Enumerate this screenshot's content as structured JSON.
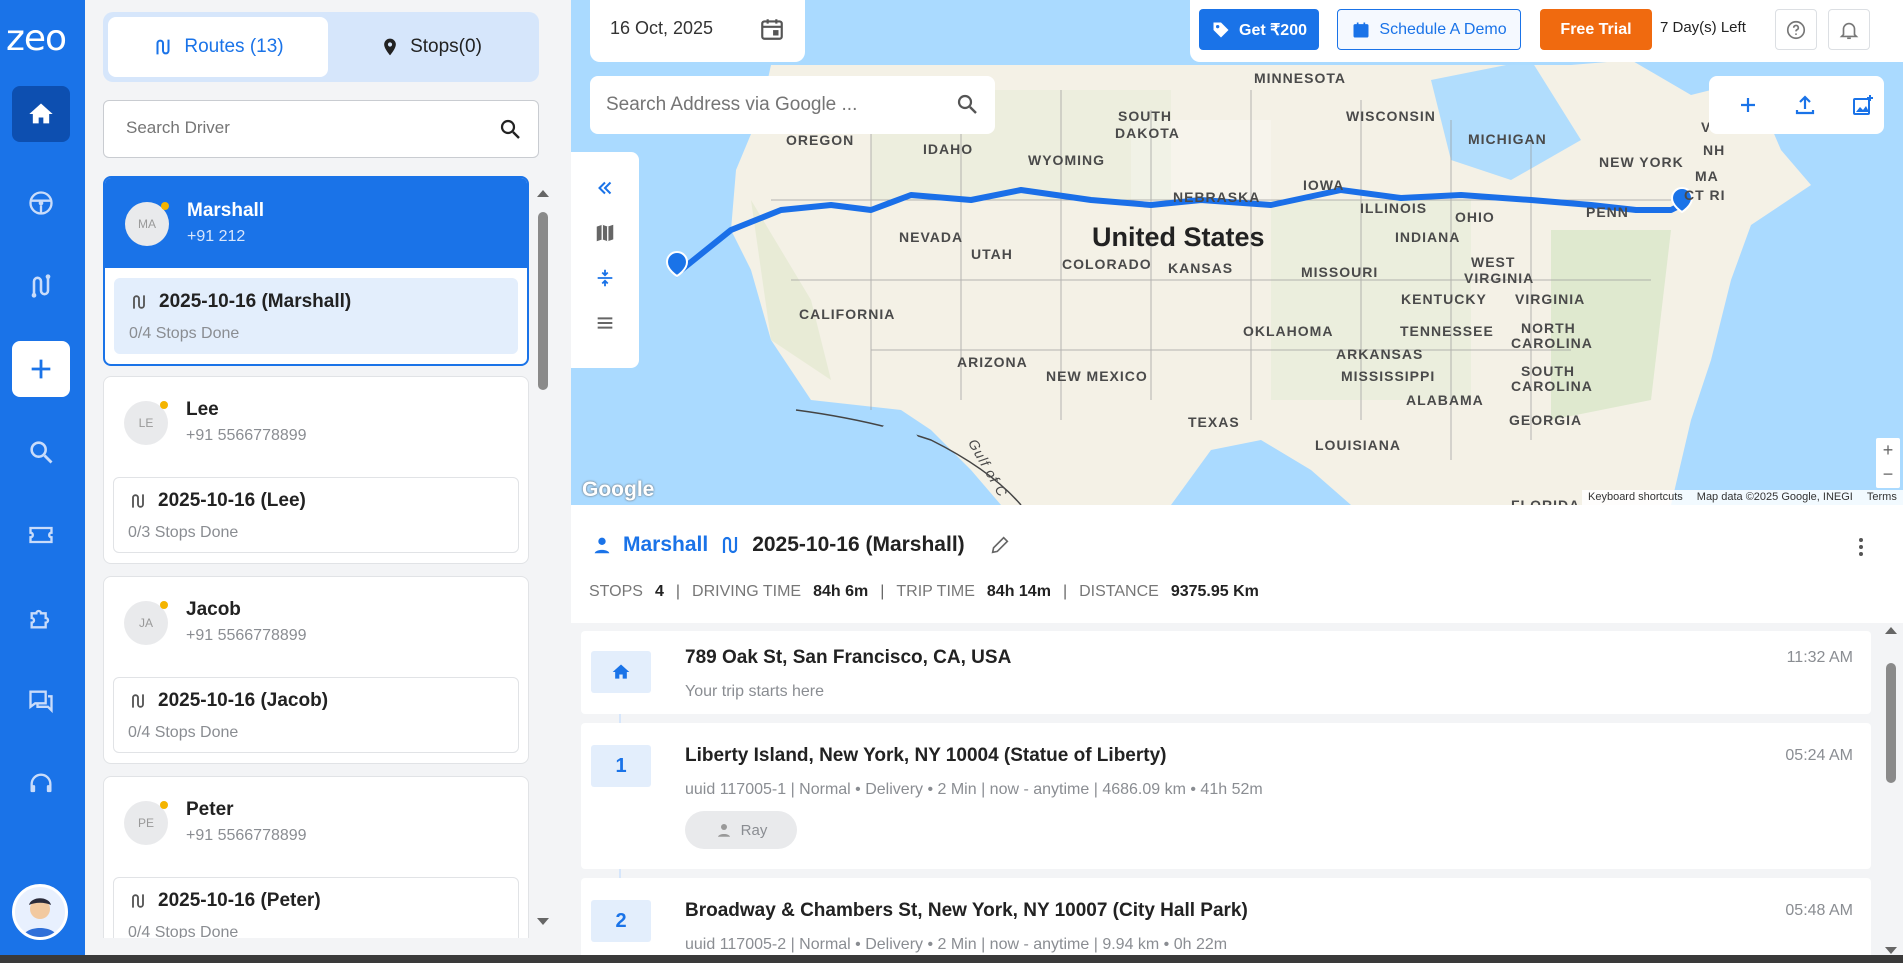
{
  "app": {
    "logo": "zeo"
  },
  "tabs": {
    "routes": "Routes (13)",
    "stops": "Stops(0)"
  },
  "search_driver": {
    "placeholder": "Search Driver"
  },
  "drivers": [
    {
      "initials": "MA",
      "name": "Marshall",
      "phone": "+91 212",
      "route": "2025-10-16 (Marshall)",
      "progress": "0/4 Stops Done"
    },
    {
      "initials": "LE",
      "name": "Lee",
      "phone": "+91 5566778899",
      "route": "2025-10-16 (Lee)",
      "progress": "0/3 Stops Done"
    },
    {
      "initials": "JA",
      "name": "Jacob",
      "phone": "+91 5566778899",
      "route": "2025-10-16 (Jacob)",
      "progress": "0/4 Stops Done"
    },
    {
      "initials": "PE",
      "name": "Peter",
      "phone": "+91 5566778899",
      "route": "2025-10-16 (Peter)",
      "progress": "0/4 Stops Done"
    }
  ],
  "topbar": {
    "date": "16 Oct, 2025",
    "get_label": "Get ₹200",
    "demo_label": "Schedule A Demo",
    "trial_label": "Free Trial",
    "days_left": "7 Day(s) Left"
  },
  "map": {
    "search_placeholder": "Search Address via Google ...",
    "google": "Google",
    "keyboard": "Keyboard shortcuts",
    "map_data": "Map data ©2025 Google, INEGI",
    "terms": "Terms",
    "labels": {
      "us": "United States",
      "oregon": "OREGON",
      "idaho": "IDAHO",
      "wyoming": "WYOMING",
      "south_dakota_1": "SOUTH",
      "south_dakota_2": "DAKOTA",
      "minnesota": "MINNESOTA",
      "wisconsin": "WISCONSIN",
      "michigan": "MICHIGAN",
      "new_york": "NEW YORK",
      "nebraska": "NEBRASKA",
      "iowa": "IOWA",
      "illinois": "ILLINOIS",
      "indiana": "INDIANA",
      "ohio": "OHIO",
      "penn": "PENN",
      "nevada": "NEVADA",
      "utah": "UTAH",
      "colorado": "COLORADO",
      "kansas": "KANSAS",
      "missouri": "MISSOURI",
      "california": "CALIFORNIA",
      "arizona": "ARIZONA",
      "new_mexico": "NEW MEXICO",
      "oklahoma": "OKLAHOMA",
      "texas": "TEXAS",
      "arkansas": "ARKANSAS",
      "mississippi": "MISSISSIPPI",
      "alabama": "ALABAMA",
      "georgia": "GEORGIA",
      "louisiana": "LOUISIANA",
      "tennessee": "TENNESSEE",
      "kentucky": "KENTUCKY",
      "virginia": "VIRGINIA",
      "west_virginia_1": "WEST",
      "west_virginia_2": "VIRGINIA",
      "north_carolina_1": "NORTH",
      "north_carolina_2": "CAROLINA",
      "south_carolina_1": "SOUTH",
      "south_carolina_2": "CAROLINA",
      "ma": "MA",
      "ct_ri": "CT RI",
      "nh": "NH",
      "vt": "VT",
      "florida": "FLORIDA",
      "gulf": "Gulf of C"
    }
  },
  "route_detail": {
    "driver": "Marshall",
    "route": "2025-10-16 (Marshall)",
    "stats": {
      "stops_label": "STOPS",
      "stops": "4",
      "driving_label": "DRIVING TIME",
      "driving": "84h 6m",
      "trip_label": "TRIP TIME",
      "trip": "84h 14m",
      "distance_label": "DISTANCE",
      "distance": "9375.95 Km"
    },
    "start": {
      "address": "789 Oak St, San Francisco, CA, USA",
      "note": "Your trip starts here",
      "time": "11:32 AM"
    },
    "stops": [
      {
        "num": "1",
        "address": "Liberty Island, New York, NY 10004 (Statue of Liberty)",
        "meta": "uuid 117005-1 |  Normal • Delivery • 2 Min |  now - anytime  |  4686.09 km • 41h 52m",
        "time": "05:24 AM",
        "chip": "Ray"
      },
      {
        "num": "2",
        "address": "Broadway & Chambers St, New York, NY 10007 (City Hall Park)",
        "meta": "uuid 117005-2 |  Normal • Delivery • 2 Min |  now - anytime  |  9.94 km • 0h 22m",
        "time": "05:48 AM"
      }
    ]
  }
}
